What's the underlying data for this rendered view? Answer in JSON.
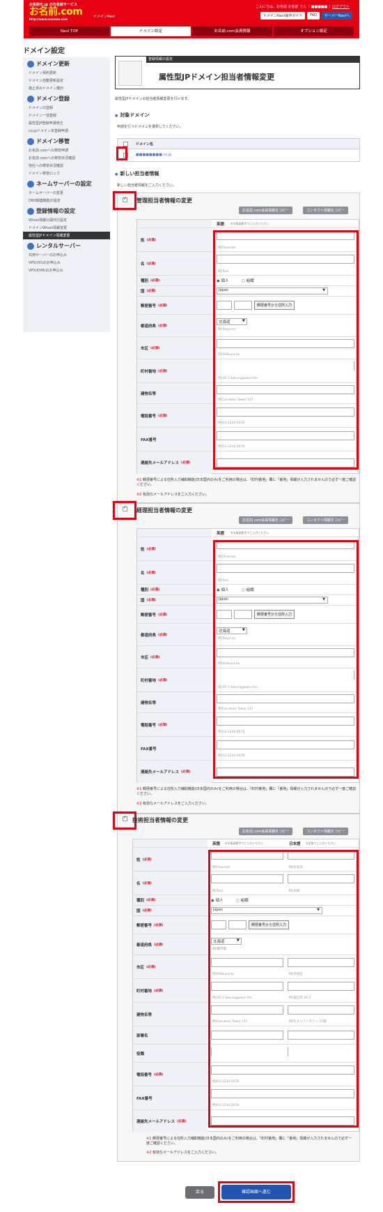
{
  "header": {
    "logo_top": "お名前を.jp のお名前サービス",
    "logo": "お名前.com",
    "logo_url": "http://www.onamae.com",
    "sub": "ドメインNavi",
    "greeting": "こんにちは、お名前 お名前 さん（",
    "logout": "ログアウト",
    "links": [
      "ドメインNavi操作ガイド",
      "FAQ",
      "サーバーNaviへ"
    ]
  },
  "tabs": [
    "Navi TOP",
    "ドメイン設定",
    "お名前.com会員情報",
    "オプション設定"
  ],
  "sidebar": {
    "title": "ドメイン設定",
    "sections": [
      {
        "title": "ドメイン更新",
        "items": [
          "ドメイン契約更新",
          "ドメイン自動更新設定",
          "廃止済みドメイン復旧"
        ]
      },
      {
        "title": "ドメイン登録",
        "items": [
          "ドメインの登録",
          "ドメイン一括登録",
          "属性型JP登録申請修正",
          "co.jpドメイン本登録申請"
        ]
      },
      {
        "title": "ドメイン移管",
        "items": [
          "お名前.comへの移管申請",
          "お名前.comへの移管状況確認",
          "他社への移管状況確認",
          "ドメイン移管ロック"
        ]
      },
      {
        "title": "ネームサーバーの設定",
        "items": [
          "ネームサーバーの変更",
          "DNS関連機能の設定"
        ]
      },
      {
        "title": "登録情報の設定",
        "items": [
          "Whois情報公開代行設定",
          "ドメインWhois情報変更",
          "属性型JPドメイン情報変更"
        ]
      },
      {
        "title": "レンタルサーバー",
        "items": [
          "共用サーバーのお申込み",
          "VPS(VD)のお申込み",
          "VPS(KVM)のお申込み"
        ]
      }
    ]
  },
  "banner": {
    "label": "登録情報の設定",
    "title": "属性型JPドメイン担当者情報変更"
  },
  "intro": "属性型JPドメインの担当者情報変更を行います。",
  "target": {
    "heading": "対象ドメイン",
    "desc": "申請を行うドメインを選択してください。",
    "col": "ドメイン名",
    "domain": "■■■■■■■■.co.jp"
  },
  "new_contact": {
    "heading": "新しい担当者情報",
    "desc": "新しい担当者情報をご入力ください。"
  },
  "buttons": {
    "copy_member": "お名前.com会員情報をコピー",
    "copy_contact": "コンタクト情報をコピー",
    "zip": "郵便番号から住所入力",
    "back": "戻る",
    "next": "確認画面へ進む"
  },
  "col_header": {
    "en": "英語",
    "en_note": "※半角英数字でご入力ください",
    "ja": "日本語",
    "ja_note": "※全角でご入力ください"
  },
  "fields": {
    "last": "姓",
    "first": "名",
    "gender": "種別",
    "country": "国",
    "zip": "郵便番号",
    "pref": "都道府県",
    "city": "市区",
    "addr": "町村番地",
    "bldg": "建物名等",
    "org": "部署名",
    "title": "役職",
    "tel": "電話番号",
    "fax": "FAX番号",
    "email": "連絡先メールアドレス",
    "required": "(必須)"
  },
  "options": {
    "individual": "個人",
    "org": "組織",
    "country": "Japan",
    "pref": "北海道"
  },
  "placeholders": {
    "last": "例)Onamae",
    "first": "例)Taro",
    "pref": "例)Tokyo-to",
    "city": "例)Shibuya-ku",
    "addr": "例)26-1 Sakuragaoka-cho",
    "bldg": "例)Cerulean Tower 11F",
    "tel": "例)03-1234-5678",
    "fax": "例)03-1234-5678",
    "last_tech": "例)Onamae",
    "first_tech": "例)Taro",
    "last_ja": "例)お名前",
    "first_ja": "例)太郎",
    "pref_ja": "例)東京都",
    "city_ja": "例)渋谷区",
    "addr_ja": "例)桜丘町 26-1",
    "bldg_ja": "例)セルリアンタワー 11階"
  },
  "sections": [
    {
      "title": "管理担当者情報の変更"
    },
    {
      "title": "経理担当者情報の変更"
    },
    {
      "title": "技術担当者情報の変更"
    }
  ],
  "notes": {
    "n1_mark": "※1",
    "n1": "郵便番号による住所入力補助機能(日本国内のみ)をご利用の場合は、「町村番地」欄に「番地」情報が入力されませんので必ず一度ご確認ください。",
    "n2_mark": "※2",
    "n2": "有効なメールアドレスをご入力ください。"
  }
}
